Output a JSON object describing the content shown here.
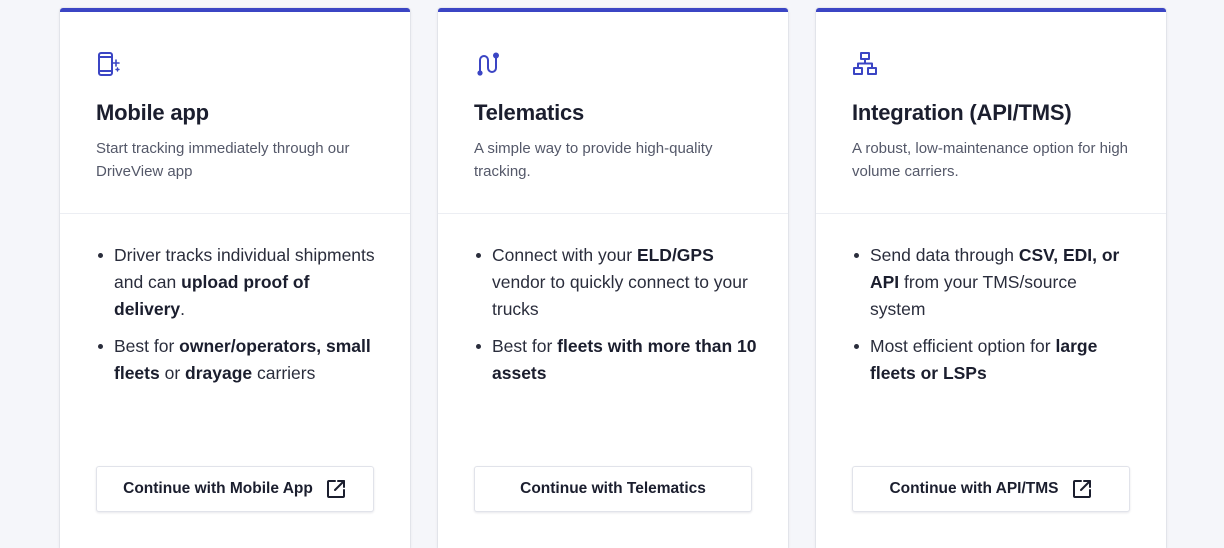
{
  "cards": [
    {
      "icon": "mobile-app-icon",
      "title": "Mobile app",
      "description": "Start tracking immediately through our DriveView app",
      "bullets": [
        [
          {
            "text": "Driver tracks individual shipments and can ",
            "bold": false
          },
          {
            "text": "upload proof of delivery",
            "bold": true
          },
          {
            "text": ".",
            "bold": false
          }
        ],
        [
          {
            "text": "Best for ",
            "bold": false
          },
          {
            "text": "owner/operators, small fleets",
            "bold": true
          },
          {
            "text": " or ",
            "bold": false
          },
          {
            "text": "drayage",
            "bold": true
          },
          {
            "text": " carriers",
            "bold": false
          }
        ]
      ],
      "cta_label": "Continue with Mobile App",
      "cta_external": true
    },
    {
      "icon": "telematics-icon",
      "title": "Telematics",
      "description": "A simple way to provide high-quality tracking.",
      "bullets": [
        [
          {
            "text": "Connect with your ",
            "bold": false
          },
          {
            "text": "ELD/GPS",
            "bold": true
          },
          {
            "text": " vendor to quickly connect to your trucks",
            "bold": false
          }
        ],
        [
          {
            "text": "Best for ",
            "bold": false
          },
          {
            "text": "fleets with more than 10 assets",
            "bold": true
          }
        ]
      ],
      "cta_label": "Continue with Telematics",
      "cta_external": false
    },
    {
      "icon": "integration-icon",
      "title": "Integration (API/TMS)",
      "description": "A robust, low-maintenance option for high volume carriers.",
      "bullets": [
        [
          {
            "text": "Send data through ",
            "bold": false
          },
          {
            "text": "CSV, EDI, or API",
            "bold": true
          },
          {
            "text": " from your TMS/source system",
            "bold": false
          }
        ],
        [
          {
            "text": "Most efficient option for ",
            "bold": false
          },
          {
            "text": "large fleets or LSPs",
            "bold": true
          }
        ]
      ],
      "cta_label": "Continue with API/TMS",
      "cta_external": true
    }
  ],
  "colors": {
    "accent": "#3b45c4",
    "text": "#1b1e2e",
    "muted": "#545869",
    "background": "#f5f6fa"
  }
}
